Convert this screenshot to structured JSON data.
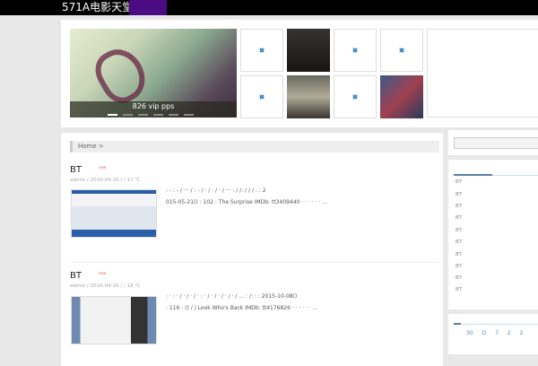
{
  "site": {
    "logo": "571A电影天堂"
  },
  "slider": {
    "caption": "826 vip pps",
    "slide_count": 6,
    "active_slide": 1
  },
  "breadcrumb": {
    "home": "Home >"
  },
  "posts": [
    {
      "title": "BT",
      "badge": "new",
      "meta": "admin / 2016-04-16 /  / 17 ℃",
      "line1": ": - : - / ··· / : - / · / · / · / ··· :  / /:  / /  / : : 2",
      "line2": "015-05-21() : 102 : The Surprise IMDb: tt3409440  · · · · · · ..."
    },
    {
      "title": "BT",
      "badge": "new",
      "meta": "admin / 2016-04-16 /  / 18 ℃",
      "line1": ": · : · / · / · / · : · / · / · / · / · / ... : /:  :  : 2015-10-08()",
      "line2": ": 116 : () /  / Look Who's Back IMDb: tt4176826  · · · · · · ..."
    }
  ],
  "sidebar": {
    "items": [
      "BT",
      "BT",
      "BT",
      "BT",
      "BT",
      "BT",
      "BT",
      "BT",
      "BT",
      "BT"
    ],
    "tags": "30 D 7 2 2"
  }
}
